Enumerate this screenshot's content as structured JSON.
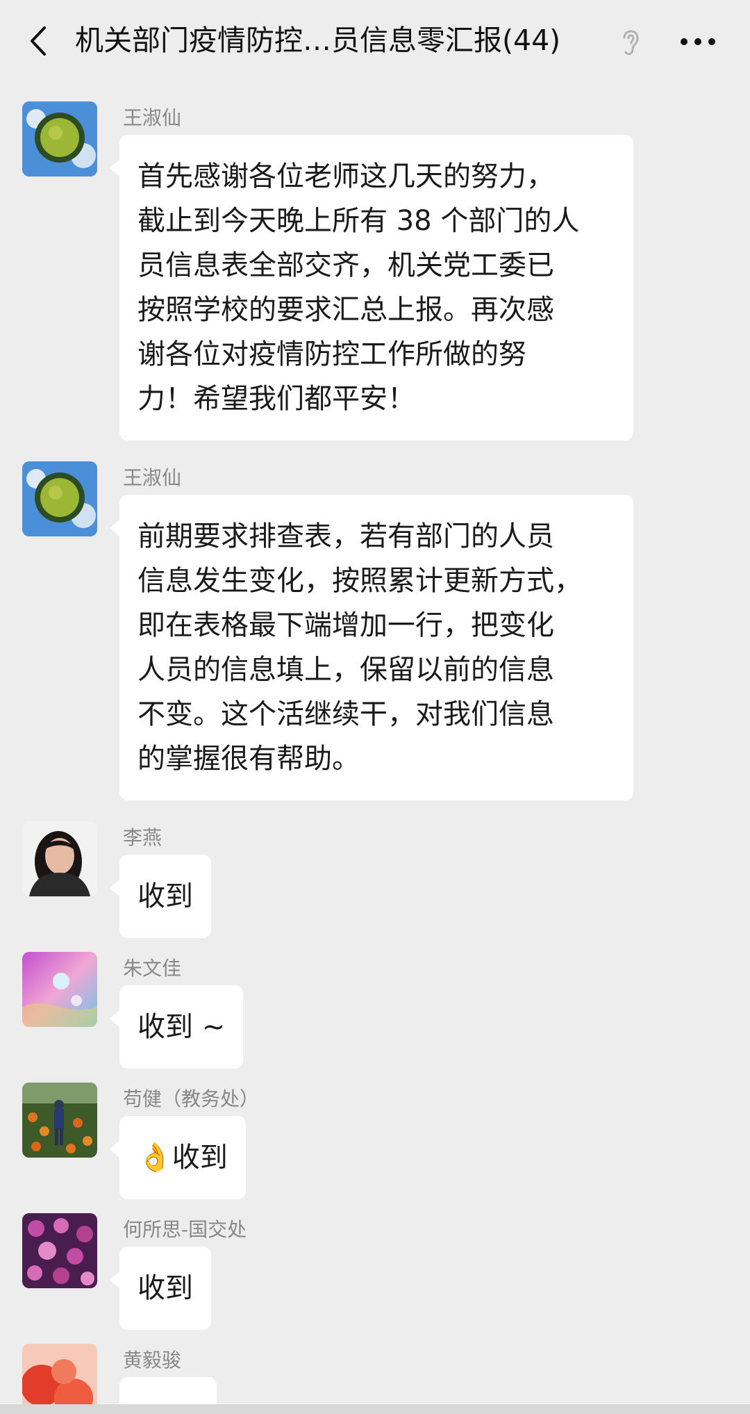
{
  "header": {
    "title": "机关部门疫情防控…员信息零汇报(44)",
    "back_icon": "chevron-left-icon",
    "ear_icon": "ear-icon",
    "more_icon": "more-icon"
  },
  "messages": [
    {
      "sender": "王淑仙",
      "lines": [
        "首先感谢各位老师这几天的努力，",
        "截止到今天晚上所有 38 个部门的人",
        "员信息表全部交齐，机关党工委已",
        "按照学校的要求汇总上报。再次感",
        "谢各位对疫情防控工作所做的努",
        "力！希望我们都平安！"
      ]
    },
    {
      "sender": "王淑仙",
      "lines": [
        "前期要求排查表，若有部门的人员",
        "信息发生变化，按照累计更新方式，",
        "即在表格最下端增加一行，把变化",
        "人员的信息填上，保留以前的信息",
        "不变。这个活继续干，对我们信息",
        "的掌握很有帮助。"
      ]
    },
    {
      "sender": "李燕",
      "text": "收到"
    },
    {
      "sender": "朱文佳",
      "text": "收到 ~"
    },
    {
      "sender": "苟健（教务处）",
      "emoji": "👌",
      "text": "收到"
    },
    {
      "sender": "何所思-国交处",
      "text": "收到"
    },
    {
      "sender": "黄毅骏",
      "text": ""
    }
  ]
}
